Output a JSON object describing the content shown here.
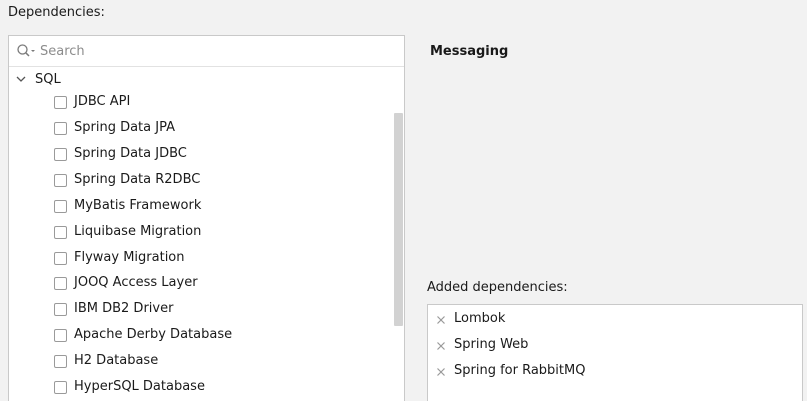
{
  "dependencies_label": "Dependencies:",
  "search": {
    "placeholder": "Search",
    "value": ""
  },
  "tree": {
    "group": {
      "label": "SQL",
      "expanded": true
    },
    "items": [
      {
        "label": "JDBC API",
        "checked": false
      },
      {
        "label": "Spring Data JPA",
        "checked": false
      },
      {
        "label": "Spring Data JDBC",
        "checked": false
      },
      {
        "label": "Spring Data R2DBC",
        "checked": false
      },
      {
        "label": "MyBatis Framework",
        "checked": false
      },
      {
        "label": "Liquibase Migration",
        "checked": false
      },
      {
        "label": "Flyway Migration",
        "checked": false
      },
      {
        "label": "JOOQ Access Layer",
        "checked": false
      },
      {
        "label": "IBM DB2 Driver",
        "checked": false
      },
      {
        "label": "Apache Derby Database",
        "checked": false
      },
      {
        "label": "H2 Database",
        "checked": false
      },
      {
        "label": "HyperSQL Database",
        "checked": false
      }
    ]
  },
  "category_title": "Messaging",
  "added": {
    "label": "Added dependencies:",
    "items": [
      {
        "label": "Lombok"
      },
      {
        "label": "Spring Web"
      },
      {
        "label": "Spring for RabbitMQ"
      }
    ]
  },
  "icons": {
    "search": "search-icon",
    "chevron": "chevron-down-icon",
    "remove": "close-icon",
    "checkbox": "checkbox-unchecked"
  },
  "colors": {
    "background": "#f2f2f2",
    "panel": "#ffffff",
    "border": "#c9c9c9",
    "text": "#1a1a1a",
    "placeholder": "#8c8c8c",
    "scrollbar_thumb": "#d2d2d2"
  }
}
